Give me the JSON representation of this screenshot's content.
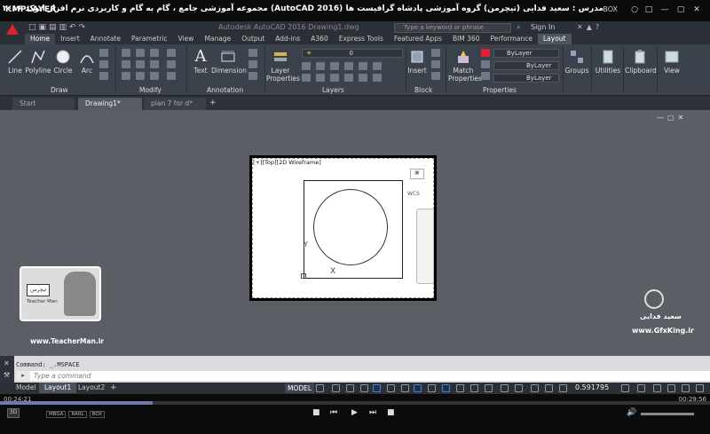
{
  "player": {
    "logo": "KMPLAYER",
    "title": "مجموعه آموزشی جامع ، گام به گام و کاربردی نرم افزار  اتوکد ۲۰۱۶ (AutoCAD 2016)  مدرس : سعید فدایی (تیچرمن) گروه آموزشی پادشاه گرافیست ها",
    "box_label": "BOX",
    "elapsed": "00:24:21",
    "total": "00:29:56",
    "progress": 0.215,
    "badges": [
      "MBGA",
      "RARL",
      "BOX"
    ]
  },
  "autocad": {
    "file_title": "Autodesk AutoCAD 2016    Drawing1.dwg",
    "search_placeholder": "Type a keyword or phrase",
    "signin": "Sign In",
    "tabs": [
      "Home",
      "Insert",
      "Annotate",
      "Parametric",
      "View",
      "Manage",
      "Output",
      "Add-ins",
      "A360",
      "Express Tools",
      "Featured Apps",
      "BIM 360",
      "Performance",
      "Layout"
    ],
    "active_tab": "Home",
    "ribbon": {
      "draw": {
        "label": "Draw",
        "tools": [
          "Line",
          "Polyline",
          "Circle",
          "Arc"
        ]
      },
      "modify": {
        "label": "Modify"
      },
      "annotation": {
        "label": "Annotation",
        "tools": [
          "Text",
          "Dimension"
        ]
      },
      "layers": {
        "label": "Layers",
        "tool": "Layer Properties",
        "layer_value": "0"
      },
      "block": {
        "label": "Block",
        "tool": "Insert"
      },
      "properties": {
        "label": "Properties",
        "tool": "Match Properties",
        "bylayer": [
          "ByLayer",
          "ByLayer",
          "ByLayer"
        ]
      },
      "groups": "Groups",
      "utilities": "Utilities",
      "clipboard": "Clipboard",
      "view": "View"
    },
    "file_tabs": [
      "Start",
      "Drawing1*",
      "plan 7 for d*"
    ],
    "active_file_tab": "Drawing1*",
    "viewport_label": "[+][Top][2D Wireframe]",
    "wcs": "WCS",
    "axis_y": "Y",
    "axis_x": "X",
    "command_history": "Command:  _.MSPACE",
    "command_placeholder": "Type a command",
    "layout_tabs": [
      "Model",
      "Layout1",
      "Layout2"
    ],
    "active_layout": "Layout1",
    "model_button": "MODEL",
    "scale_value": "0.591795"
  },
  "watermarks": {
    "left_url": "www.TeacherMan.ir",
    "left_badge": "تیچرمن",
    "left_sub": "Teacher Man",
    "right_name": "سعید فدایی",
    "right_url": "www.GfxKing.ir"
  }
}
